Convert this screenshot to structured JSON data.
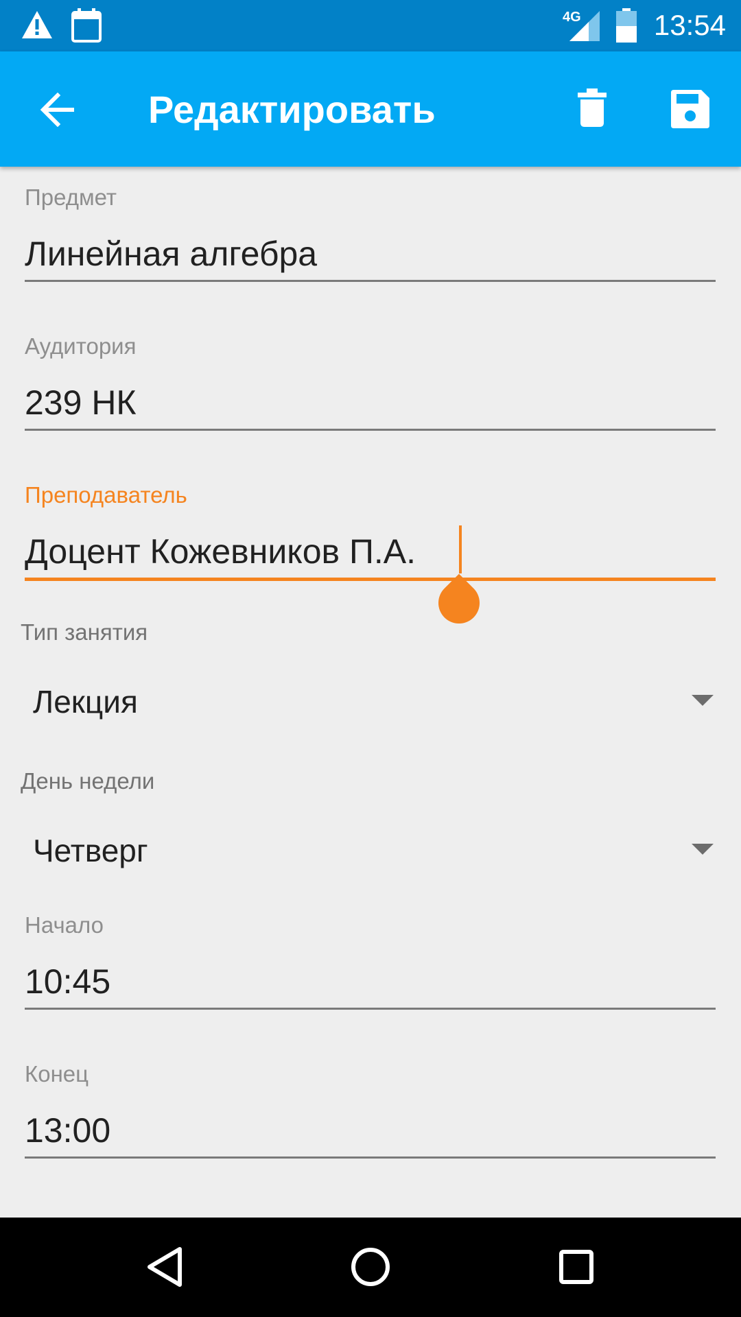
{
  "status_bar": {
    "time": "13:54",
    "network": "4G",
    "icons": [
      "warning-icon",
      "calendar-icon",
      "signal-icon",
      "battery-icon"
    ]
  },
  "app_bar": {
    "title": "Редактировать",
    "actions": [
      "back-arrow-icon",
      "delete-icon",
      "save-icon"
    ]
  },
  "form": {
    "subject": {
      "label": "Предмет",
      "value": "Линейная алгебра"
    },
    "room": {
      "label": "Аудитория",
      "value": "239 НК"
    },
    "teacher": {
      "label": "Преподаватель",
      "value": "Доцент Кожевников П.А."
    },
    "lesson_type": {
      "label": "Тип занятия",
      "value": "Лекция"
    },
    "weekday": {
      "label": "День недели",
      "value": "Четверг"
    },
    "start": {
      "label": "Начало",
      "value": "10:45"
    },
    "end": {
      "label": "Конец",
      "value": "13:00"
    }
  },
  "colors": {
    "status_bar": "#0281c7",
    "app_bar": "#03a9f4",
    "accent": "#f5841f",
    "background": "#eeeeee"
  },
  "nav_bar": {
    "buttons": [
      "back-triangle-icon",
      "home-circle-icon",
      "recents-square-icon"
    ]
  }
}
